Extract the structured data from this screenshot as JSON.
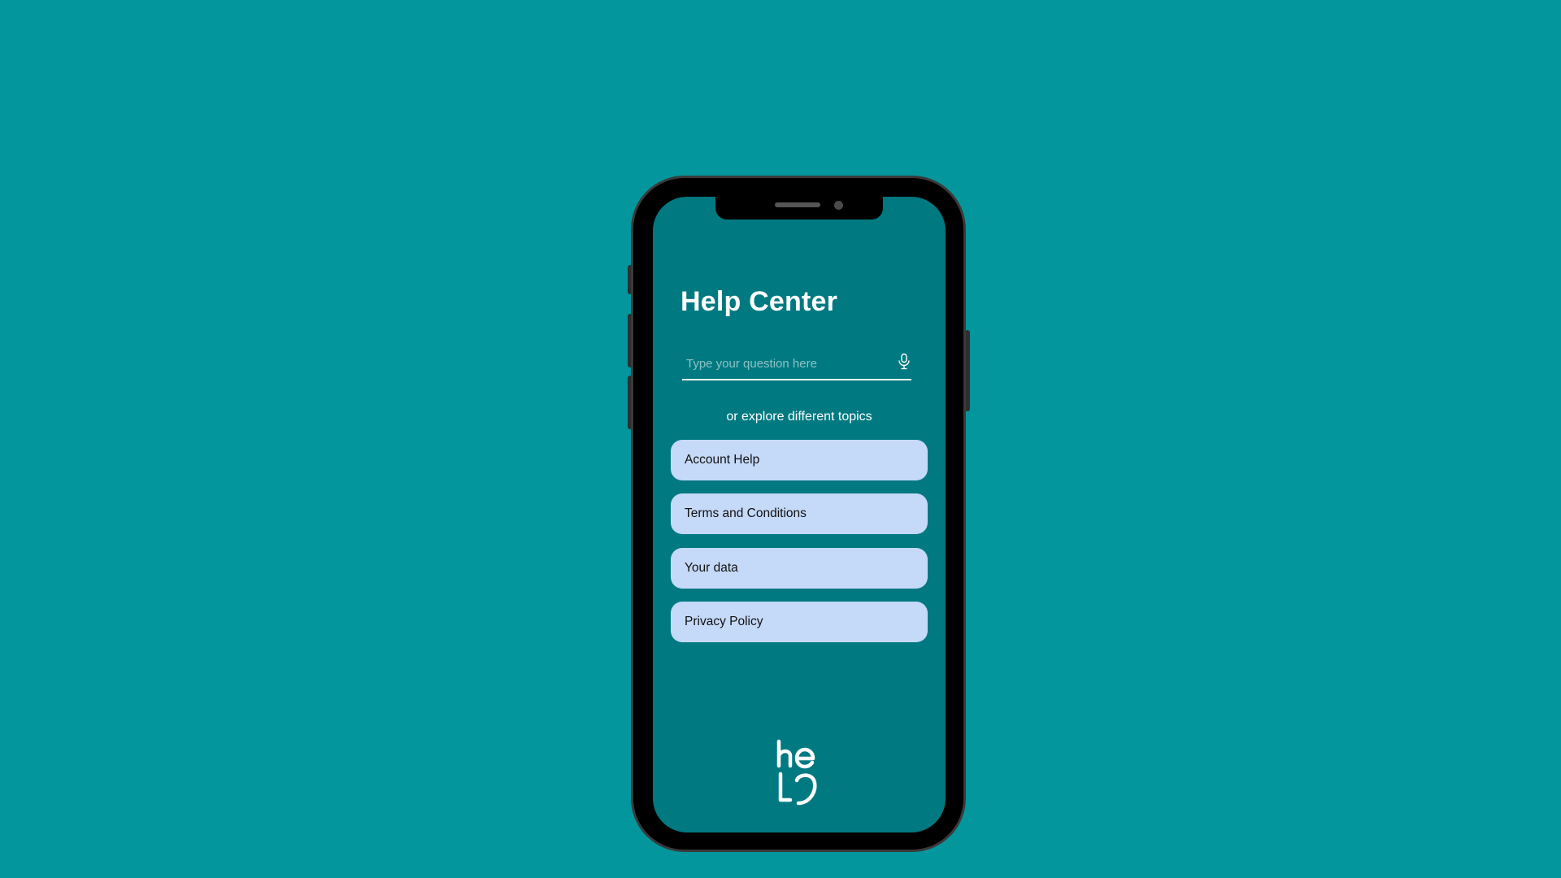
{
  "app": {
    "title": "Help Center",
    "logo_text": "help"
  },
  "search": {
    "placeholder": "Type your question here",
    "value": "",
    "icon": "microphone-icon"
  },
  "explore": {
    "label": "or explore different topics"
  },
  "topics": [
    {
      "label": "Account Help"
    },
    {
      "label": "Terms and Conditions"
    },
    {
      "label": "Your data"
    },
    {
      "label": "Privacy Policy"
    }
  ],
  "colors": {
    "background": "#03979d",
    "screen": "#007981",
    "topic_button": "#c5d9f8",
    "text_light": "#ffffff"
  }
}
